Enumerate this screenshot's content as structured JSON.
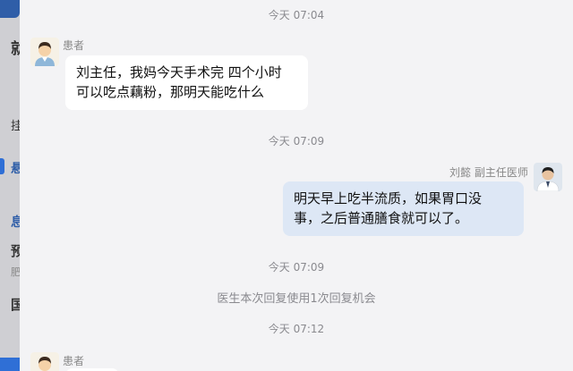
{
  "underlay": {
    "chars": [
      "就",
      "挂",
      "悬",
      "息",
      "预",
      "肥",
      "国"
    ]
  },
  "chat": {
    "times": [
      "今天 07:04",
      "今天 07:09",
      "今天 07:09",
      "今天 07:12"
    ],
    "messages": [
      {
        "sender": "患者",
        "side": "left",
        "lines": [
          "刘主任，我妈今天手术完 四个小时",
          "可以吃点藕粉，那明天能吃什么"
        ]
      },
      {
        "sender": "刘懿 副主任医师",
        "side": "right",
        "lines": [
          "明天早上吃半流质，如果胃口没",
          "事，之后普通膳食就可以了。"
        ]
      },
      {
        "sender": "患者",
        "side": "left",
        "lines": []
      }
    ],
    "notice": "医生本次回复使用1次回复机会"
  },
  "colors": {
    "background": "#f3f3f5",
    "doctor_bubble": "#dde7f5",
    "patient_bubble": "#ffffff",
    "accent": "#2f6fd6"
  }
}
